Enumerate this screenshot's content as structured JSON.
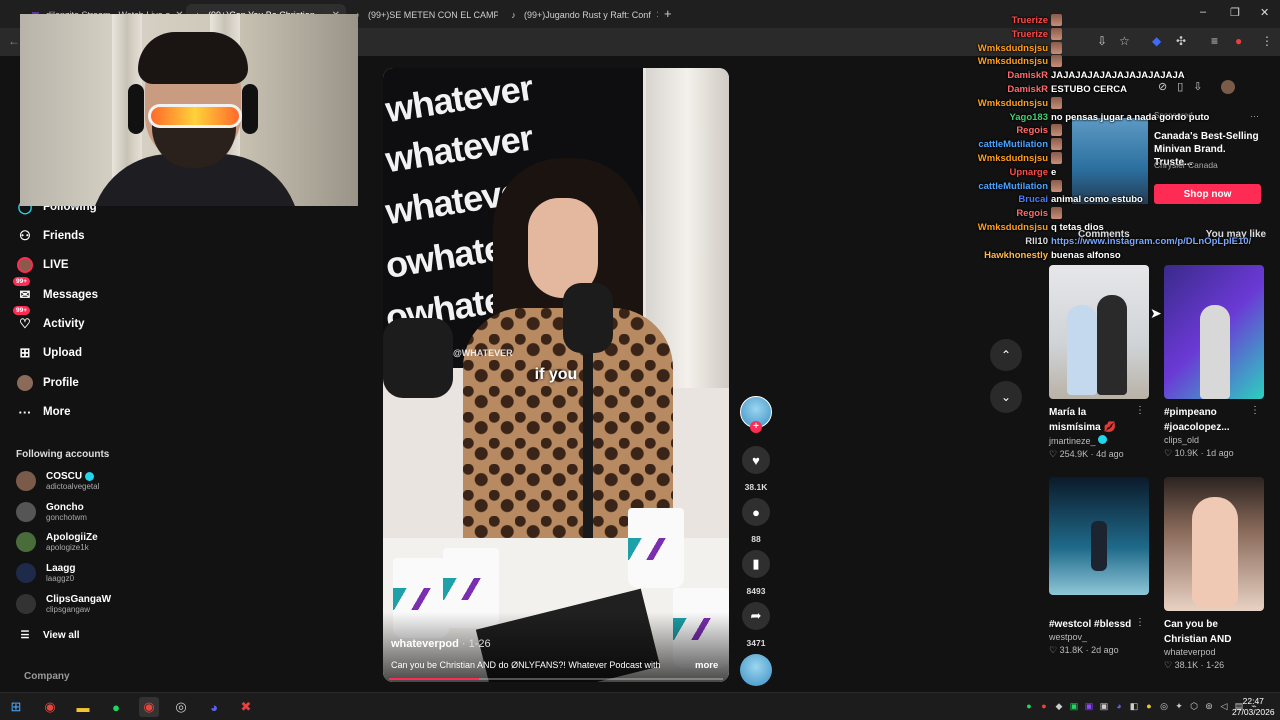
{
  "browser": {
    "tabs": [
      {
        "label": "dilanzito Stream - Watch Live o",
        "icon": "twitch-icon",
        "color": "#9146ff"
      },
      {
        "label": "(99+)Can You Be Christian",
        "icon": "tiktok-icon",
        "color": "#ffffff"
      },
      {
        "label": "(99+)SE METEN CON EL CAMPI",
        "icon": "tiktok-icon",
        "color": "#ffffff"
      },
      {
        "label": "(99+)Jugando Rust y Raft: Conf",
        "icon": "tiktok-icon",
        "color": "#ffffff"
      }
    ],
    "new_tab": "+",
    "window_controls": [
      "–",
      "❐",
      "✕"
    ]
  },
  "sidebar": {
    "items": [
      {
        "label": "Following",
        "icon": "following-icon",
        "glyph": "◯"
      },
      {
        "label": "Friends",
        "icon": "friends-icon",
        "glyph": "👥"
      },
      {
        "label": "LIVE",
        "icon": "live-icon",
        "glyph": "●"
      },
      {
        "label": "Messages",
        "icon": "messages-icon",
        "glyph": "✉",
        "badge": "99+"
      },
      {
        "label": "Activity",
        "icon": "activity-icon",
        "glyph": "♡",
        "badge": "99+"
      },
      {
        "label": "Upload",
        "icon": "upload-icon",
        "glyph": "⊞"
      },
      {
        "label": "Profile",
        "icon": "profile-icon",
        "glyph": "●"
      },
      {
        "label": "More",
        "icon": "more-icon",
        "glyph": "···"
      }
    ],
    "following_title": "Following accounts",
    "accounts": [
      {
        "name": "COSCU",
        "handle": "adictoalvegetal",
        "verified": true,
        "color": "#7a5a48"
      },
      {
        "name": "Goncho",
        "handle": "gonchotwm",
        "verified": false,
        "color": "#555"
      },
      {
        "name": "ApologiiZe",
        "handle": "apologize1k",
        "verified": false,
        "color": "#4a6b3a"
      },
      {
        "name": "Laagg",
        "handle": "laaggz0",
        "verified": false,
        "color": "#1e2a4a"
      },
      {
        "name": "ClipsGangaW",
        "handle": "clipsgangaw",
        "verified": false,
        "color": "#333"
      }
    ],
    "view_all": "View all",
    "company": "Company"
  },
  "video": {
    "brand_words": [
      "whatever",
      "whatever",
      "whatever",
      "owhatever",
      "owhatever"
    ],
    "watermark": "@WHATEVER",
    "caption": "if you",
    "author": "whateverpod",
    "date": " · 1-26",
    "description": "Can you be Christian AND do ØNLYFANS?! Whatever Podcast with",
    "more": "more",
    "progress": 0.27
  },
  "actions": {
    "likes": "38.1K",
    "comments": "88",
    "saves": "8493",
    "shares": "3471"
  },
  "right_panel": {
    "sponsored": "Sponsored",
    "ad_title": "Canada's Best-Selling Minivan Brand. Truste...",
    "ad_brand": "Chrysler Canada",
    "ad_button": "Shop now",
    "tab_comments": "Comments",
    "tab_you_may_like": "You may like",
    "cards": [
      {
        "title": "María la mismísima 💋",
        "user": "jmartineze_",
        "likes": "254.9K",
        "date": "4d ago"
      },
      {
        "title": "#pimpeano #joacolopez...",
        "user": "clips_old",
        "likes": "10.9K",
        "date": "1d ago"
      },
      {
        "title": "#westcol #blessd",
        "user": "westpov_",
        "likes": "31.8K",
        "date": "2d ago"
      },
      {
        "title": "Can you be Christian AND do...",
        "user": "whateverpod",
        "likes": "38.1K",
        "date": "1-26"
      }
    ]
  },
  "chat": [
    {
      "user": "Truerize",
      "color": "#ff4a4a",
      "msg": "",
      "emote": true
    },
    {
      "user": "Truerize",
      "color": "#ff4a4a",
      "msg": "",
      "emote": true
    },
    {
      "user": "Wmksdudnsjsu",
      "color": "#ff9f1a",
      "msg": "",
      "emote": true
    },
    {
      "user": "Wmksdudnsjsu",
      "color": "#ff9f1a",
      "msg": "",
      "emote": true
    },
    {
      "user": "DamiskR",
      "color": "#ff6b6b",
      "msg": "JAJAJAJAJAJAJAJAJAJAJA",
      "emote": false
    },
    {
      "user": "DamiskR",
      "color": "#ff6b6b",
      "msg": "ESTUBO CERCA",
      "emote": false
    },
    {
      "user": "Wmksdudnsjsu",
      "color": "#ff9f1a",
      "msg": "",
      "emote": true
    },
    {
      "user": "Yago183",
      "color": "#3fd16b",
      "msg": "no pensas jugar a nada gordo puto",
      "emote": false
    },
    {
      "user": "Regois",
      "color": "#ff6b6b",
      "msg": "",
      "emote": true
    },
    {
      "user": "cattleMutilation",
      "color": "#4aa3ff",
      "msg": "",
      "emote": true
    },
    {
      "user": "Wmksdudnsjsu",
      "color": "#ff9f1a",
      "msg": "",
      "emote": true
    },
    {
      "user": "Upnarge",
      "color": "#ff4a4a",
      "msg": "e",
      "emote": false
    },
    {
      "user": "cattleMutilation",
      "color": "#4aa3ff",
      "msg": "",
      "emote": true
    },
    {
      "user": "Brucai",
      "color": "#4a7aff",
      "msg": "animal como estubo",
      "emote": false
    },
    {
      "user": "Regois",
      "color": "#ff6b6b",
      "msg": "",
      "emote": true
    },
    {
      "user": "Wmksdudnsjsu",
      "color": "#ff9f1a",
      "msg": "q tetas dios",
      "emote": false
    },
    {
      "user": "Rll10",
      "color": "#dddddd",
      "msg": "https://www.instagram.com/p/DLnOpLplE10/",
      "emote": false
    },
    {
      "user": "Hawkhonestly",
      "color": "#ffb84a",
      "msg": "buenas alfonso",
      "emote": false
    }
  ],
  "clock": {
    "time": "22:47",
    "date": "27/03/2026"
  }
}
